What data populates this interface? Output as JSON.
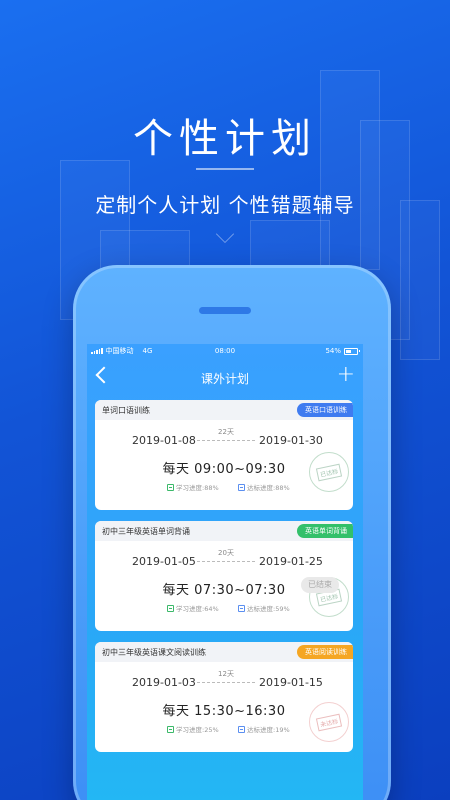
{
  "hero": {
    "title": "个性计划",
    "subtitle": "定制个人计划 个性错题辅导"
  },
  "status_bar": {
    "carrier": "中国移动",
    "network": "4G",
    "time": "08:00",
    "battery": "54%"
  },
  "nav": {
    "title": "课外计划",
    "back_icon": "chevron-left-icon",
    "add_icon": "plus-icon"
  },
  "cards": [
    {
      "title": "单词口语训练",
      "tag": "英语口语训练",
      "tag_color": "#3f7bf0",
      "start_date": "2019-01-08",
      "days": "22天",
      "end_date": "2019-01-30",
      "time": "每天 09:00~09:30",
      "study_progress": "学习进度:88%",
      "target_progress": "达标进度:88%",
      "stamp_text": "已达标",
      "stamp_color": "green"
    },
    {
      "title": "初中三年级英语单词背诵",
      "tag": "英语单词背诵",
      "tag_color": "#33c06a",
      "start_date": "2019-01-05",
      "days": "20天",
      "end_date": "2019-01-25",
      "time": "每天 07:30~07:30",
      "status": "已结束",
      "study_progress": "学习进度:64%",
      "target_progress": "达标进度:59%",
      "stamp_text": "已达标",
      "stamp_color": "green"
    },
    {
      "title": "初中三年级英语课文阅读训练",
      "tag": "英语阅读训练",
      "tag_color": "#f5a623",
      "start_date": "2019-01-03",
      "days": "12天",
      "end_date": "2019-01-15",
      "time": "每天 15:30~16:30",
      "study_progress": "学习进度:25%",
      "target_progress": "达标进度:19%",
      "stamp_text": "未达标",
      "stamp_color": "red"
    }
  ]
}
